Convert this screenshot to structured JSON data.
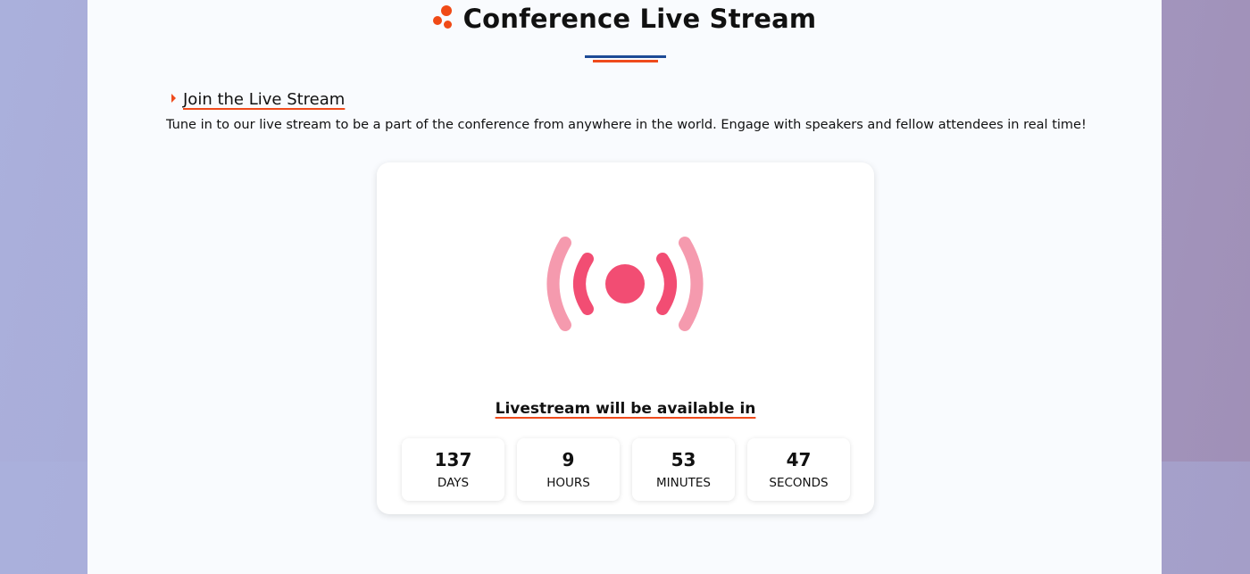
{
  "header": {
    "title": "Conference Live Stream",
    "icon": "dots-logo-icon",
    "accent": "#ef4b1c",
    "secondary": "#1d4b96"
  },
  "section": {
    "heading": "Join the Live Stream",
    "description": "Tune in to our live stream to be a part of the conference from anywhere in the world. Engage with speakers and fellow attendees in real time!"
  },
  "card": {
    "icon": "live-broadcast-icon",
    "availability_text": "Livestream will be available in",
    "countdown": [
      {
        "value": "137",
        "label": "DAYS"
      },
      {
        "value": "9",
        "label": "HOURS"
      },
      {
        "value": "53",
        "label": "MINUTES"
      },
      {
        "value": "47",
        "label": "SECONDS"
      }
    ]
  }
}
